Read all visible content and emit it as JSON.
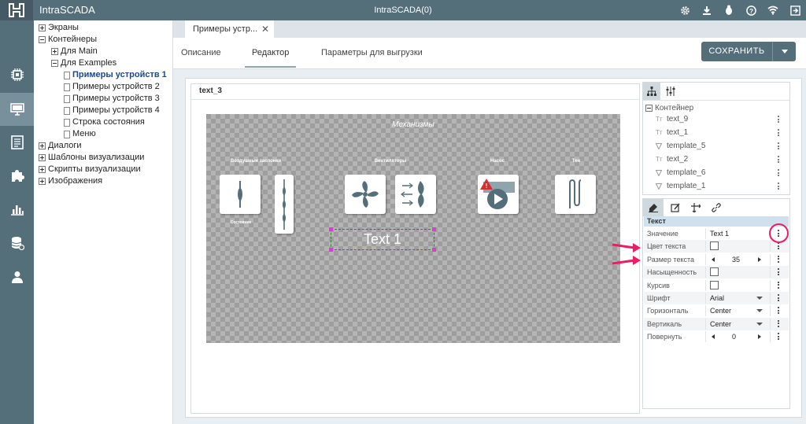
{
  "app": {
    "name": "IntraSCADA",
    "center_title": "IntraSCADA(0)"
  },
  "topbar_icons": [
    "gear-icon",
    "download-icon",
    "bug-icon",
    "help-icon",
    "wifi-icon",
    "logout-icon"
  ],
  "leftbar": {
    "items": [
      "chip-icon",
      "monitor-icon",
      "document-list-icon",
      "puzzle-icon",
      "chart-icon",
      "database-icon",
      "user-icon"
    ],
    "active": "monitor-icon"
  },
  "tree": {
    "items": [
      {
        "label": "Экраны",
        "level": 0,
        "toggle": "plus"
      },
      {
        "label": "Контейнеры",
        "level": 0,
        "toggle": "minus"
      },
      {
        "label": "Для Main",
        "level": 1,
        "toggle": "plus"
      },
      {
        "label": "Для Examples",
        "level": 1,
        "toggle": "minus"
      },
      {
        "label": "Примеры устройств 1",
        "level": 2,
        "toggle": "doc",
        "selected": true
      },
      {
        "label": "Примеры устройств 2",
        "level": 2,
        "toggle": "doc"
      },
      {
        "label": "Примеры устройств 3",
        "level": 2,
        "toggle": "doc"
      },
      {
        "label": "Примеры устройств 4",
        "level": 2,
        "toggle": "doc"
      },
      {
        "label": "Строка состояния",
        "level": 2,
        "toggle": "doc"
      },
      {
        "label": "Меню",
        "level": 2,
        "toggle": "doc"
      },
      {
        "label": "Диалоги",
        "level": 0,
        "toggle": "plus"
      },
      {
        "label": "Шаблоны визуализации",
        "level": 0,
        "toggle": "plus"
      },
      {
        "label": "Скрипты визуализации",
        "level": 0,
        "toggle": "plus"
      },
      {
        "label": "Изображения",
        "level": 0,
        "toggle": "plus"
      }
    ]
  },
  "doc_tab": {
    "label": "Примеры устр...",
    "close": "✕"
  },
  "subnav": {
    "tabs": [
      "Описание",
      "Редактор",
      "Параметры для выгрузки"
    ],
    "active": "Редактор"
  },
  "save": {
    "label": "СОХРАНИТЬ"
  },
  "canvas": {
    "title": "text_3"
  },
  "stage": {
    "title": "Механизмы",
    "groups": [
      "Воздушные заслонки",
      "Вентиляторы",
      "Насос",
      "Тен"
    ],
    "state_label": "Состояние",
    "text_widget": "Text 1"
  },
  "structure": {
    "root": "Контейнер",
    "items": [
      {
        "name": "text_9",
        "kind": "text"
      },
      {
        "name": "text_1",
        "kind": "text"
      },
      {
        "name": "template_5",
        "kind": "template"
      },
      {
        "name": "text_2",
        "kind": "text"
      },
      {
        "name": "template_6",
        "kind": "template"
      },
      {
        "name": "template_1",
        "kind": "template"
      }
    ],
    "text_kind_icon": "Tт"
  },
  "props": {
    "section": "Текст",
    "rows": [
      {
        "label": "Значение",
        "type": "text",
        "value": "Text 1"
      },
      {
        "label": "Цвет текста",
        "type": "check"
      },
      {
        "label": "Размер текста",
        "type": "number",
        "value": "35"
      },
      {
        "label": "Насыщенность",
        "type": "check"
      },
      {
        "label": "Курсив",
        "type": "check"
      },
      {
        "label": "Шрифт",
        "type": "select",
        "value": "Arial"
      },
      {
        "label": "Горизонталь",
        "type": "select",
        "value": "Center"
      },
      {
        "label": "Вертикаль",
        "type": "select",
        "value": "Center"
      },
      {
        "label": "Повернуть",
        "type": "number",
        "value": "0"
      }
    ]
  },
  "colors": {
    "topbar": "#546e7a",
    "accent": "#546e7a",
    "highlight": "#e91e63"
  }
}
